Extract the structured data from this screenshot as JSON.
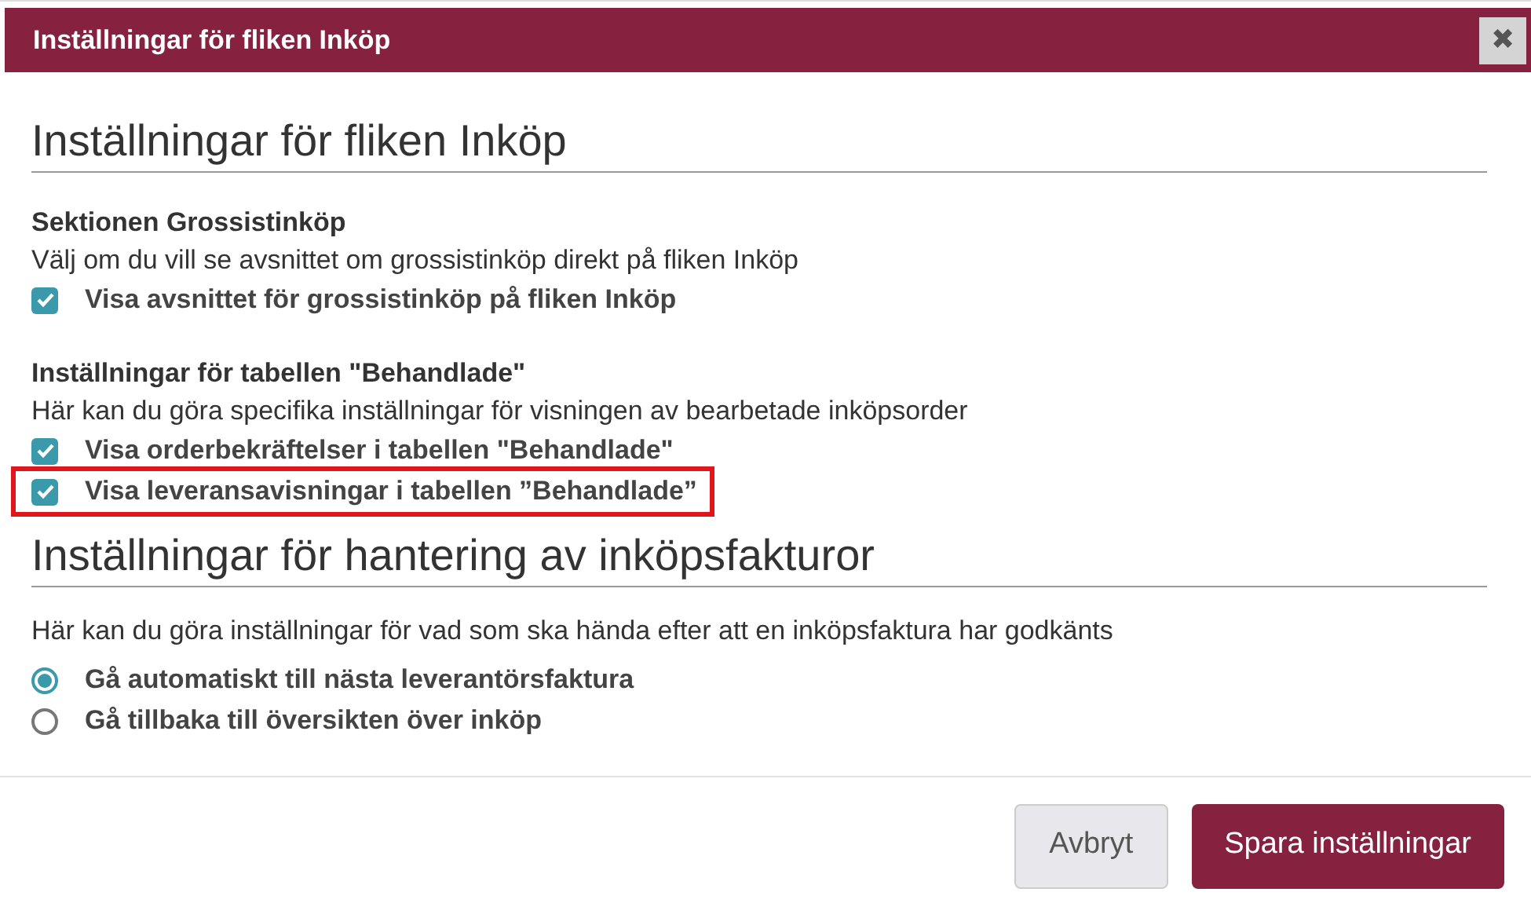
{
  "window": {
    "title": "Inställningar för fliken Inköp",
    "close": "✖"
  },
  "sections": [
    {
      "heading": "Inställningar för fliken Inköp",
      "groups": [
        {
          "title": "Sektionen Grossistinköp",
          "description": "Välj om du vill se avsnittet om grossistinköp direkt på fliken Inköp",
          "options": [
            {
              "kind": "checkbox",
              "label": "Visa avsnittet för grossistinköp på fliken Inköp",
              "checked": true,
              "highlighted": false
            }
          ]
        },
        {
          "title": "Inställningar för tabellen \"Behandlade\"",
          "description": "Här kan du göra specifika inställningar för visningen av bearbetade inköpsorder",
          "options": [
            {
              "kind": "checkbox",
              "label": "Visa orderbekräftelser i tabellen \"Behandlade\"",
              "checked": true,
              "highlighted": false
            },
            {
              "kind": "checkbox",
              "label": "Visa leveransavisningar i tabellen ”Behandlade”",
              "checked": true,
              "highlighted": true
            }
          ]
        }
      ]
    },
    {
      "heading": "Inställningar för hantering av inköpsfakturor",
      "groups": [
        {
          "description": "Här kan du göra inställningar för vad som ska hända efter att en inköpsfaktura har godkänts",
          "options": [
            {
              "kind": "radio",
              "label": "Gå automatiskt till nästa leverantörsfaktura",
              "selected": true,
              "highlighted": false
            },
            {
              "kind": "radio",
              "label": "Gå tillbaka till översikten över inköp",
              "selected": false,
              "highlighted": false
            }
          ]
        }
      ]
    }
  ],
  "buttons": [
    {
      "label": "Avbryt",
      "kind": "secondary"
    },
    {
      "label": "Spara inställningar",
      "kind": "primary"
    }
  ]
}
